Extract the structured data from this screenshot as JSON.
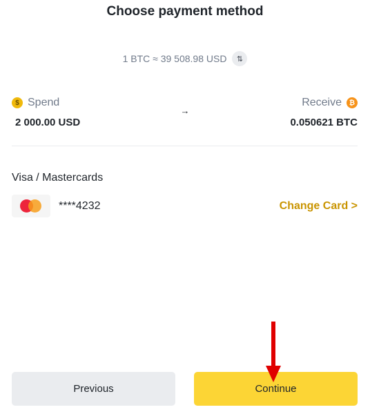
{
  "header": {
    "title": "Choose payment method"
  },
  "rate": {
    "text": "1 BTC ≈ 39 508.98 USD",
    "swap_icon": "swap-vertical-icon"
  },
  "spend": {
    "label": "Spend",
    "amount": "2 000.00 USD",
    "coin_icon": "usd-coin-icon",
    "coin_glyph": "$"
  },
  "exchange_arrow": "→",
  "receive": {
    "label": "Receive",
    "amount": "0.050621 BTC",
    "coin_icon": "btc-coin-icon",
    "coin_glyph": "₿"
  },
  "payment": {
    "section_label": "Visa / Mastercards",
    "card_number": "****4232",
    "card_brand_icon": "mastercard-logo-icon",
    "change_card_label": "Change Card >"
  },
  "buttons": {
    "previous": "Previous",
    "continue": "Continue"
  },
  "colors": {
    "primary_yellow": "#fcd535",
    "link_gold": "#c99400",
    "annotation_red": "#e00000"
  }
}
